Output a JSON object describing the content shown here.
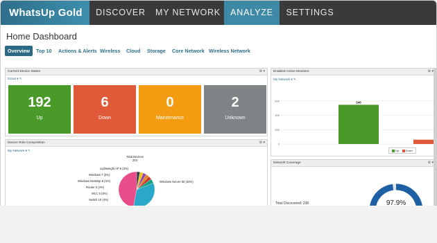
{
  "app": {
    "logo": "WhatsUp Gold",
    "nav": [
      "DISCOVER",
      "MY NETWORK",
      "ANALYZE",
      "SETTINGS"
    ],
    "active_nav": "ANALYZE"
  },
  "page": {
    "title": "Home Dashboard",
    "tabs": [
      "Overview",
      "Top 10",
      "Actions & Alerts",
      "Wireless",
      "Cloud",
      "Storage",
      "Core Network",
      "Wireless Network"
    ],
    "active_tab": "Overview"
  },
  "device_states": {
    "title": "Current Device States",
    "filter": "Cloud",
    "tiles": [
      {
        "value": "192",
        "label": "Up",
        "color": "#4a9a2a"
      },
      {
        "value": "6",
        "label": "Down",
        "color": "#e05a3a"
      },
      {
        "value": "0",
        "label": "Maintenance",
        "color": "#f39c12"
      },
      {
        "value": "2",
        "label": "Unknown",
        "color": "#7f8486"
      }
    ]
  },
  "role_composition": {
    "title": "Device Role Composition",
    "filter": "My Network",
    "total_label": "Total Devices",
    "total_value": "223",
    "slice_labels": [
      "Lightweight AP 6 (3%)",
      "Windows 7 (3%)",
      "Windows Desktop 8 (3%)",
      "Router 6 (3%)",
      "WLC 5 (3%)",
      "Switch 10 (4%)",
      "Windows Server 80 (34%)"
    ],
    "slice_values": [
      3,
      3,
      3,
      3,
      3,
      4,
      34,
      47
    ],
    "slice_colors": [
      "#2c3e50",
      "#f1c40f",
      "#8e44ad",
      "#e67e22",
      "#c0392b",
      "#16a085",
      "#2aa8c9",
      "#e84c8a"
    ]
  },
  "active_monitors": {
    "title": "Enabled Active Monitors",
    "filter": "My Network",
    "chart_data": {
      "type": "bar",
      "categories": [
        "Up",
        "Down"
      ],
      "values": [
        546,
        60
      ],
      "data_labels": [
        "546",
        ""
      ],
      "ylim": [
        0,
        800
      ],
      "y_ticks": [
        0,
        200,
        400,
        600
      ],
      "colors": [
        "#4a9a2a",
        "#e05a3a"
      ],
      "legend": [
        "Up",
        "Down"
      ]
    }
  },
  "network_coverage": {
    "title": "Network Coverage",
    "total_discovered": "Total Discovered: 238",
    "percent": "97.9%",
    "fraction": 0.979
  },
  "colors": {
    "nav_bg": "#3a3a3a",
    "accent": "#3e8aa6",
    "link": "#2d6f8b"
  }
}
